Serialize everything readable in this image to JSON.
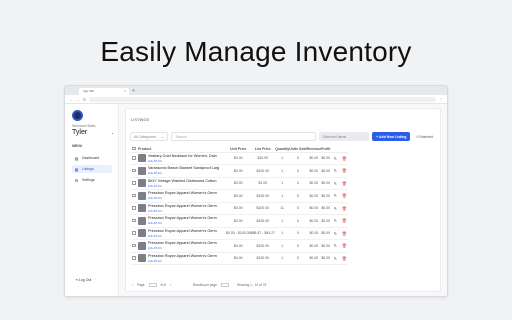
{
  "headline": "Easily Manage Inventory",
  "browser": {
    "tab_title": "App Tab",
    "tab_close": "×",
    "new_tab": "+",
    "back": "←",
    "forward": "→",
    "reload": "↻",
    "menu": "⋮"
  },
  "sidebar": {
    "welcome": "Welcome Back,",
    "user": "Tyler",
    "menu_label": "MENU",
    "items": [
      {
        "label": "Dashboard",
        "icon": "▤"
      },
      {
        "label": "Listings",
        "icon": "▦"
      },
      {
        "label": "Settings",
        "icon": "⚙"
      }
    ],
    "logout": "Log Out"
  },
  "main": {
    "title": "LISTINGS",
    "category_select": "All Categories",
    "search_placeholder": "Search",
    "bulk_action": "Selected Items",
    "add_button": "+ Add New Listing",
    "selected_count": "0 Selected",
    "columns": [
      "Product",
      "Unit Price",
      "List Price",
      "Quantity",
      "Units Sold",
      "Revenue",
      "Profit"
    ],
    "rows": [
      {
        "name": "Vestiary Gold Necklace for Women, Dain",
        "sku": "LNL-87-K4",
        "unit": "$0.00",
        "list": "$10.00",
        "qty": "1",
        "sold": "0",
        "rev": "$0.00",
        "profit": "$0.00"
      },
      {
        "name": "Vantasonic Beach Blanket Sandproof Larg",
        "sku": "LNL-87-K4",
        "unit": "$0.00",
        "list": "$100.00",
        "qty": "1",
        "sold": "0",
        "rev": "$0.00",
        "profit": "$0.00"
      },
      {
        "name": "BKIY Vintage Washed Distressed Cotton",
        "sku": "LNL-87-K4",
        "unit": "$0.00",
        "list": "$1.00",
        "qty": "1",
        "sold": "0",
        "rev": "$0.00",
        "profit": "$0.00"
      },
      {
        "name": "Pressbox Royce Apparel Women's Germ",
        "sku": "LNL-87-K4",
        "unit": "$0.00",
        "list": "$100.00",
        "qty": "1",
        "sold": "0",
        "rev": "$0.00",
        "profit": "$0.00"
      },
      {
        "name": "Pressbox Royce Apparel Women's Germ",
        "sku": "LNL-87-K4",
        "unit": "$0.00",
        "list": "$100.00",
        "qty": "11",
        "sold": "0",
        "rev": "$0.00",
        "profit": "$0.00"
      },
      {
        "name": "Pressbox Royce Apparel Women's Germ",
        "sku": "LNL-87-K4",
        "unit": "$0.00",
        "list": "$100.00",
        "qty": "1",
        "sold": "0",
        "rev": "$0.00",
        "profit": "$0.00"
      },
      {
        "name": "Pressbox Royce Apparel Women's Germ",
        "sku": "LNL-87-K4",
        "unit": "$0.00 - $100.00",
        "list": "$88.87 - $94.27",
        "qty": "1",
        "sold": "0",
        "rev": "$0.00",
        "profit": "$0.00"
      },
      {
        "name": "Pressbox Royce Apparel Women's Germ",
        "sku": "LNL-87-K4",
        "unit": "$0.00",
        "list": "$100.00",
        "qty": "1",
        "sold": "0",
        "rev": "$0.00",
        "profit": "$0.00"
      },
      {
        "name": "Pressbox Royce Apparel Women's Germ",
        "sku": "LNL-87-K4",
        "unit": "$0.00",
        "list": "$100.00",
        "qty": "1",
        "sold": "0",
        "rev": "$0.00",
        "profit": "$0.00"
      }
    ],
    "pager": {
      "page_label": "Page",
      "page": "1",
      "of": "of 8",
      "rows_label": "Results per page",
      "rows": "10",
      "showing": "Showing 1 - 10 of 75"
    },
    "edit_icon": "✎",
    "delete_icon": "🗑"
  }
}
